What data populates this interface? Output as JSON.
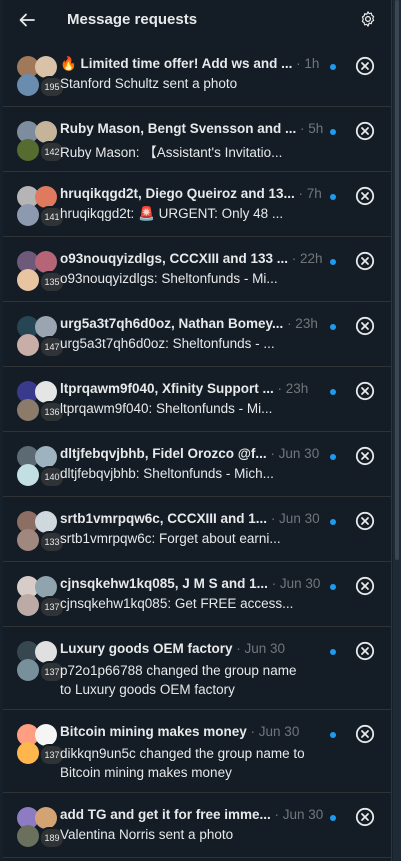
{
  "header": {
    "title": "Message requests"
  },
  "colors": {
    "unread_dot": "#1d9bf0",
    "background": "#15202b",
    "text": "#e7e9ea",
    "muted": "#71767b"
  },
  "requests": [
    {
      "title": "🔥 Limited time offer! Add ws and ...",
      "time": "1h",
      "preview": "Stanford Schultz sent a photo",
      "count": "195",
      "icons": [
        "avatar-photo",
        "avatar-photo",
        "avatar-photo"
      ]
    },
    {
      "title": "Ruby Mason, Bengt Svensson and ...",
      "time": "5h",
      "preview": "Ruby Mason: 【Assistant's Invitatio...",
      "count": "142",
      "icons": [
        "avatar-photo",
        "avatar-photo",
        "avatar-photo"
      ]
    },
    {
      "title": "hruqikqgd2t, Diego Queiroz and 13...",
      "time": "7h",
      "preview": "hruqikqgd2t: 🚨 URGENT: Only 48 ...",
      "count": "141",
      "icons": [
        "avatar-photo",
        "avatar-photo",
        "avatar-photo"
      ]
    },
    {
      "title": "o93nouqyizdlgs, CCCXIII and 133 ...",
      "time": "22h",
      "preview": "o93nouqyizdlgs: Sheltonfunds - Mi...",
      "count": "135",
      "icons": [
        "avatar-photo",
        "avatar-photo",
        "avatar-photo"
      ]
    },
    {
      "title": "urg5a3t7qh6d0oz, Nathan Bomey...",
      "time": "23h",
      "preview": "urg5a3t7qh6d0oz: Sheltonfunds - ...",
      "count": "147",
      "icons": [
        "avatar-photo",
        "avatar-photo",
        "avatar-photo"
      ]
    },
    {
      "title": "ltprqawm9f040, Xfinity Support ...",
      "time": "23h",
      "preview": "ltprqawm9f040: Sheltonfunds - Mi...",
      "count": "136",
      "icons": [
        "avatar-photo",
        "avatar-photo",
        "avatar-photo"
      ]
    },
    {
      "title": "dltjfebqvjbhb, Fidel Orozco @f...",
      "time": "Jun 30",
      "preview": "dltjfebqvjbhb: Sheltonfunds - Mich...",
      "count": "140",
      "icons": [
        "avatar-photo",
        "avatar-photo",
        "avatar-photo"
      ]
    },
    {
      "title": "srtb1vmrpqw6c, CCCXIII and 1...",
      "time": "Jun 30",
      "preview": "srtb1vmrpqw6c: Forget about earni...",
      "count": "133",
      "icons": [
        "avatar-photo",
        "avatar-photo",
        "avatar-photo"
      ]
    },
    {
      "title": "cjnsqkehw1kq085, J M S and 1...",
      "time": "Jun 30",
      "preview": "cjnsqkehw1kq085: Get FREE access...",
      "count": "137",
      "icons": [
        "avatar-photo",
        "avatar-photo",
        "avatar-photo"
      ]
    },
    {
      "title": "Luxury goods OEM factory",
      "time": "Jun 30",
      "preview": "p72o1p66788 changed the group name to Luxury goods OEM factory",
      "count": "137",
      "tall": true,
      "icons": [
        "avatar-photo",
        "avatar-photo",
        "avatar-photo"
      ]
    },
    {
      "title": "Bitcoin mining makes money",
      "time": "Jun 30",
      "preview": "dikkqn9un5c changed the group name to Bitcoin mining makes money",
      "count": "137",
      "tall": true,
      "icons": [
        "avatar-photo",
        "avatar-photo",
        "avatar-photo"
      ]
    },
    {
      "title": "add TG and get it for free imme...",
      "time": "Jun 30",
      "preview": "Valentina Norris sent a photo",
      "count": "189",
      "icons": [
        "avatar-photo",
        "avatar-photo",
        "avatar-photo"
      ]
    }
  ]
}
